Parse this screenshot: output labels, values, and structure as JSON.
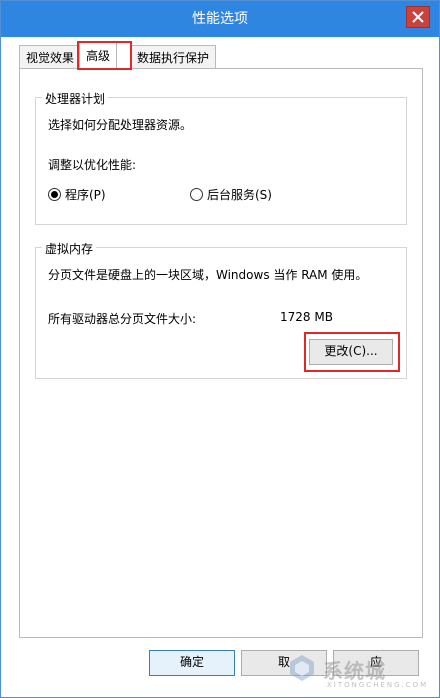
{
  "window": {
    "title": "性能选项"
  },
  "tabs": [
    {
      "label": "视觉效果"
    },
    {
      "label": "高级"
    },
    {
      "label": "数据执行保护"
    }
  ],
  "processor": {
    "legend": "处理器计划",
    "description": "选择如何分配处理器资源。",
    "adjust_label": "调整以优化性能:",
    "options": [
      {
        "label": "程序(P)",
        "checked": true
      },
      {
        "label": "后台服务(S)",
        "checked": false
      }
    ]
  },
  "virtual_memory": {
    "legend": "虚拟内存",
    "description": "分页文件是硬盘上的一块区域，Windows 当作 RAM 使用。",
    "total_label": "所有驱动器总分页文件大小:",
    "total_value": "1728 MB",
    "change_button": "更改(C)..."
  },
  "buttons": {
    "ok": "确定",
    "cancel": "取",
    "apply": "应"
  },
  "watermark": {
    "text": "系统城",
    "subtext": "XITONGCHENG.COM"
  },
  "colors": {
    "titlebar": "#2f86e0",
    "close_button": "#c8433e",
    "highlight_box": "#e02a2a"
  }
}
